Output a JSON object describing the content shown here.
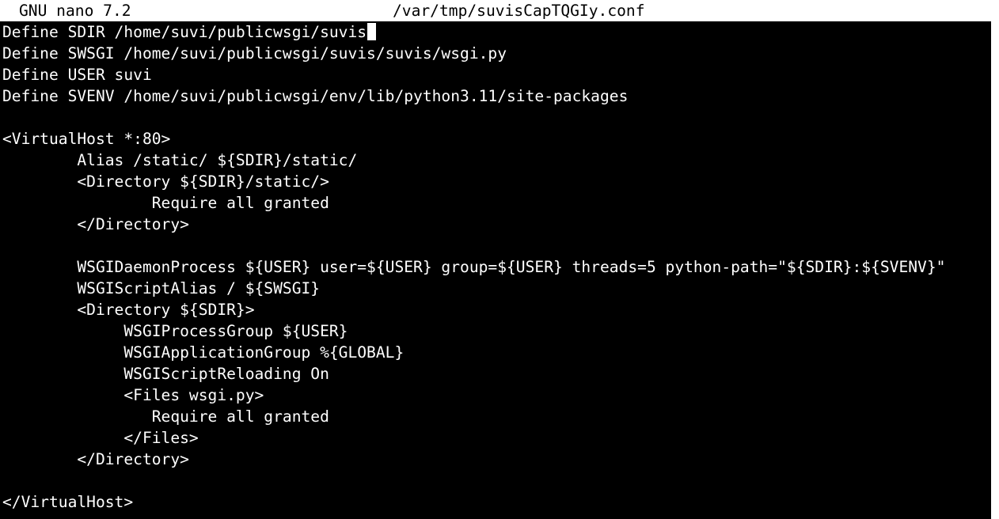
{
  "titlebar": {
    "app": "GNU nano 7.2",
    "filename": "/var/tmp/suvisCapTQGIy.conf"
  },
  "editor": {
    "lines": [
      "Define SDIR /home/suvi/publicwsgi/suvis",
      "Define SWSGI /home/suvi/publicwsgi/suvis/suvis/wsgi.py",
      "Define USER suvi",
      "Define SVENV /home/suvi/publicwsgi/env/lib/python3.11/site-packages",
      "",
      "<VirtualHost *:80>",
      "        Alias /static/ ${SDIR}/static/",
      "        <Directory ${SDIR}/static/>",
      "                Require all granted",
      "        </Directory>",
      "",
      "        WSGIDaemonProcess ${USER} user=${USER} group=${USER} threads=5 python-path=\"${SDIR}:${SVENV}\"",
      "        WSGIScriptAlias / ${SWSGI}",
      "        <Directory ${SDIR}>",
      "             WSGIProcessGroup ${USER}",
      "             WSGIApplicationGroup %{GLOBAL}",
      "             WSGIScriptReloading On",
      "             <Files wsgi.py>",
      "                Require all granted",
      "             </Files>",
      "        </Directory>",
      "",
      "</VirtualHost>"
    ]
  }
}
